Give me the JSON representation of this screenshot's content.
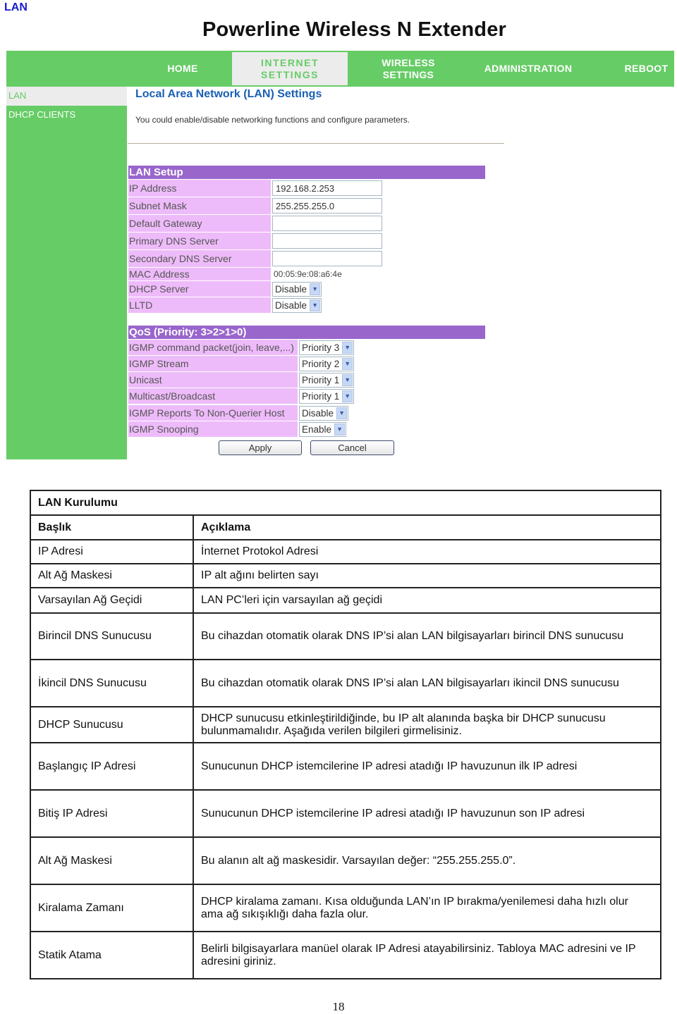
{
  "section_label": "LAN",
  "router": {
    "title": "Powerline Wireless N Extender",
    "nav": [
      {
        "label": "HOME",
        "active": false
      },
      {
        "label": "INTERNET SETTINGS",
        "active": true
      },
      {
        "label": "WIRELESS SETTINGS",
        "active": false
      },
      {
        "label": "ADMINISTRATION",
        "active": false
      },
      {
        "label": "REBOOT",
        "active": false
      }
    ],
    "sidebar": [
      {
        "label": "LAN",
        "active": true
      },
      {
        "label": "DHCP CLIENTS",
        "active": false
      }
    ],
    "page_heading": "Local Area Network (LAN) Settings",
    "page_description": "You could enable/disable networking functions and configure parameters.",
    "lan_setup": {
      "title": "LAN Setup",
      "fields": [
        {
          "label": "IP Address",
          "type": "text",
          "value": "192.168.2.253"
        },
        {
          "label": "Subnet Mask",
          "type": "text",
          "value": "255.255.255.0"
        },
        {
          "label": "Default Gateway",
          "type": "text",
          "value": ""
        },
        {
          "label": "Primary DNS Server",
          "type": "text",
          "value": ""
        },
        {
          "label": "Secondary DNS Server",
          "type": "text",
          "value": ""
        },
        {
          "label": "MAC Address",
          "type": "static",
          "value": "00:05:9e:08:a6:4e"
        },
        {
          "label": "DHCP Server",
          "type": "select",
          "value": "Disable"
        },
        {
          "label": "LLTD",
          "type": "select",
          "value": "Disable"
        }
      ]
    },
    "qos": {
      "title": "QoS (Priority: 3>2>1>0)",
      "fields": [
        {
          "label": "IGMP command packet(join, leave,...)",
          "value": "Priority 3"
        },
        {
          "label": "IGMP Stream",
          "value": "Priority 2"
        },
        {
          "label": "Unicast",
          "value": "Priority 1"
        },
        {
          "label": "Multicast/Broadcast",
          "value": "Priority 1"
        },
        {
          "label": "IGMP Reports To Non-Querier Host",
          "value": "Disable"
        },
        {
          "label": "IGMP Snooping",
          "value": "Enable"
        }
      ]
    },
    "buttons": {
      "apply": "Apply",
      "cancel": "Cancel"
    },
    "colors": {
      "nav_green": "#66cc66",
      "section_purple": "#9966cc",
      "label_pink": "#eebbfa",
      "heading_blue": "#1a5fb4"
    }
  },
  "doc_table": {
    "title": "LAN Kurulumu",
    "headers": [
      "Başlık",
      "Açıklama"
    ],
    "rows": [
      [
        "IP Adresi",
        "İnternet Protokol Adresi"
      ],
      [
        "Alt Ağ Maskesi",
        "IP alt ağını belirten sayı"
      ],
      [
        "Varsayılan Ağ Geçidi",
        "LAN PC’leri için varsayılan ağ geçidi"
      ],
      [
        "Birincil DNS Sunucusu",
        "Bu cihazdan otomatik olarak DNS IP’si alan LAN bilgisayarları birincil DNS sunucusu"
      ],
      [
        "İkincil DNS Sunucusu",
        "Bu cihazdan otomatik olarak DNS IP’si alan LAN bilgisayarları ikincil DNS sunucusu"
      ],
      [
        "DHCP Sunucusu",
        "DHCP sunucusu etkinleştirildiğinde, bu IP alt alanında başka bir DHCP sunucusu bulunmamalıdır. Aşağıda verilen bilgileri girmelisiniz."
      ],
      [
        "Başlangıç IP Adresi",
        "Sunucunun DHCP istemcilerine IP adresi atadığı IP havuzunun ilk IP adresi"
      ],
      [
        "Bitiş IP Adresi",
        "Sunucunun DHCP istemcilerine IP adresi atadığı IP havuzunun son IP adresi"
      ],
      [
        "Alt Ağ Maskesi",
        "Bu alanın alt ağ maskesidir. Varsayılan değer: “255.255.255.0”."
      ],
      [
        "Kiralama Zamanı",
        "DHCP kiralama zamanı. Kısa olduğunda LAN’ın IP bırakma/yenilemesi daha hızlı olur ama ağ sıkışıklığı daha fazla olur."
      ],
      [
        "Statik Atama",
        "Belirli bilgisayarlara manüel olarak IP Adresi atayabilirsiniz. Tabloya MAC adresini ve IP adresini giriniz."
      ]
    ]
  },
  "page_number": "18"
}
